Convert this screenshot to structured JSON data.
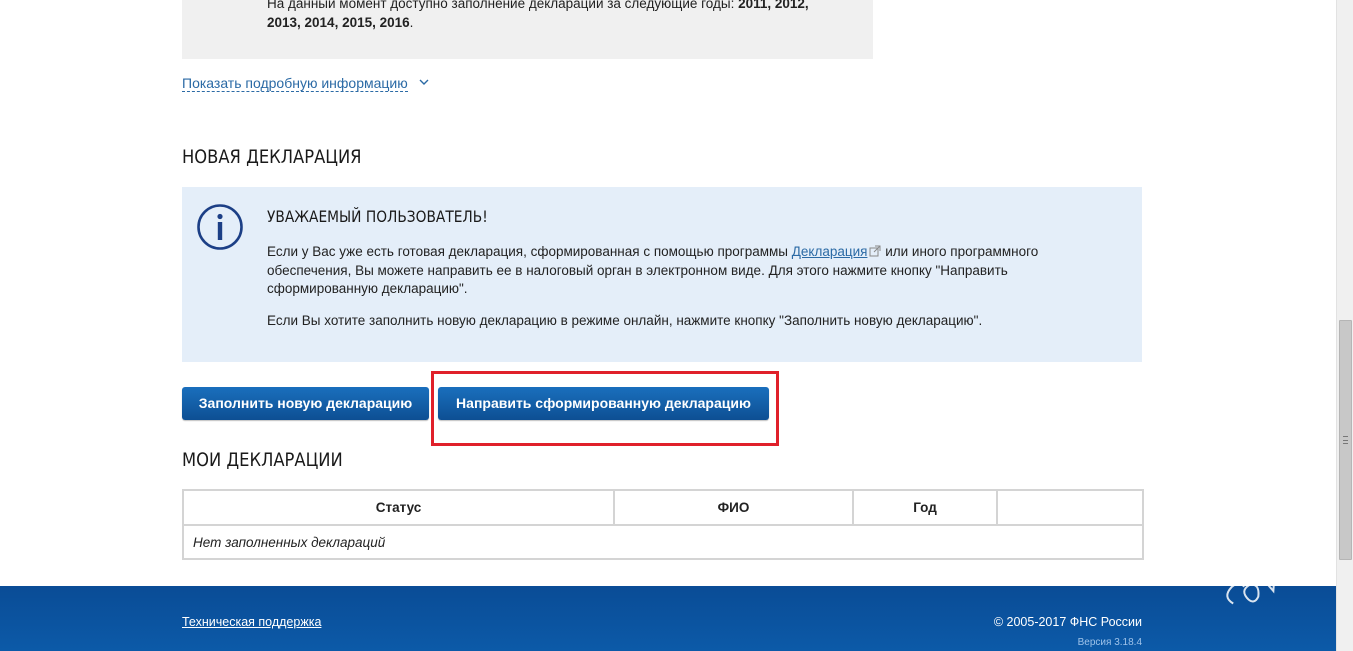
{
  "years_notice": {
    "line1_prefix": "На данный момент доступно заполнение деклараций за следующие годы: ",
    "line1_years": "2011, 2012,",
    "line2_years": "2013, 2014, 2015, 2016",
    "line2_suffix": "."
  },
  "show_more_link": "Показать подробную информацию",
  "new_declaration": {
    "heading": "НОВАЯ ДЕКЛАРАЦИЯ",
    "info_title": "УВАЖАЕМЫЙ ПОЛЬЗОВАТЕЛЬ!",
    "p1_before_link": "Если у Вас уже есть готовая декларация, сформированная с помощью программы ",
    "p1_link": "Декларация",
    "p1_after_link": " или иного программного обеспечения, Вы можете направить ее в налоговый орган в электронном виде. Для этого нажмите кнопку \"Направить сформированную декларацию\".",
    "p2": "Если Вы хотите заполнить новую декларацию в режиме онлайн, нажмите кнопку \"Заполнить новую декларацию\"."
  },
  "buttons": {
    "fill_new": "Заполнить новую декларацию",
    "send_formed": "Направить сформированную декларацию"
  },
  "my_declarations": {
    "heading": "МОИ ДЕКЛАРАЦИИ",
    "columns": [
      "Статус",
      "ФИО",
      "Год",
      ""
    ],
    "empty_message": "Нет заполненных деклараций"
  },
  "footer": {
    "support_link": "Техническая поддержка",
    "copyright": "© 2005-2017 ФНС России",
    "version": "Версия 3.18.4"
  },
  "colors": {
    "accent_blue": "#0d5ca8",
    "link_blue": "#2b6aa5",
    "highlight_red": "#e0202a",
    "info_bg": "#e4eef9"
  },
  "icons": {
    "info": "info-circle-icon",
    "chevron": "chevron-down-icon",
    "external": "external-link-icon",
    "watermark": "clubsovet-logo"
  }
}
